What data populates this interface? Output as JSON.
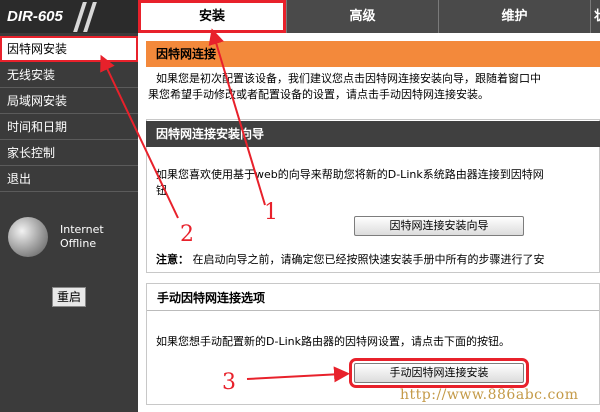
{
  "header": {
    "logo": "DIR-605",
    "tabs": [
      {
        "label": "安装",
        "active": true
      },
      {
        "label": "高级",
        "active": false
      },
      {
        "label": "维护",
        "active": false
      },
      {
        "label": "状",
        "active": false
      }
    ]
  },
  "sidebar": {
    "items": [
      {
        "label": "因特网安装",
        "active": true
      },
      {
        "label": "无线安装",
        "active": false
      },
      {
        "label": "局域网安装",
        "active": false
      },
      {
        "label": "时间和日期",
        "active": false
      },
      {
        "label": "家长控制",
        "active": false
      },
      {
        "label": "退出",
        "active": false
      }
    ],
    "status_line1": "Internet",
    "status_line2": "Offline",
    "reboot_label": "重启"
  },
  "main": {
    "section1": {
      "title": "因特网连接",
      "line1": "如果您是初次配置该设备，我们建议您点击因特网连接安装向导，跟随着窗口中",
      "line2": "果您希望手动修改或者配置设备的设置，请点击手动因特网连接安装。"
    },
    "section2": {
      "title": "因特网连接安装向导",
      "line1": "如果您喜欢使用基于web的向导来帮助您将新的D-Link系统路由器连接到因特网",
      "line2": "钮",
      "button_label": "因特网连接安装向导",
      "note_label": "注意：",
      "note_text": "在启动向导之前，请确定您已经按照快速安装手册中所有的步骤进行了安"
    },
    "section3": {
      "title": "手动因特网连接选项",
      "line1": "如果您想手动配置新的D-Link路由器的因特网设置，请点击下面的按钮。",
      "button_label": "手动因特网连接安装"
    }
  },
  "annotations": {
    "marker1": "1",
    "marker2": "2",
    "marker3": "3",
    "color": "#e8212b"
  },
  "watermark": "http://www.886abc.com"
}
